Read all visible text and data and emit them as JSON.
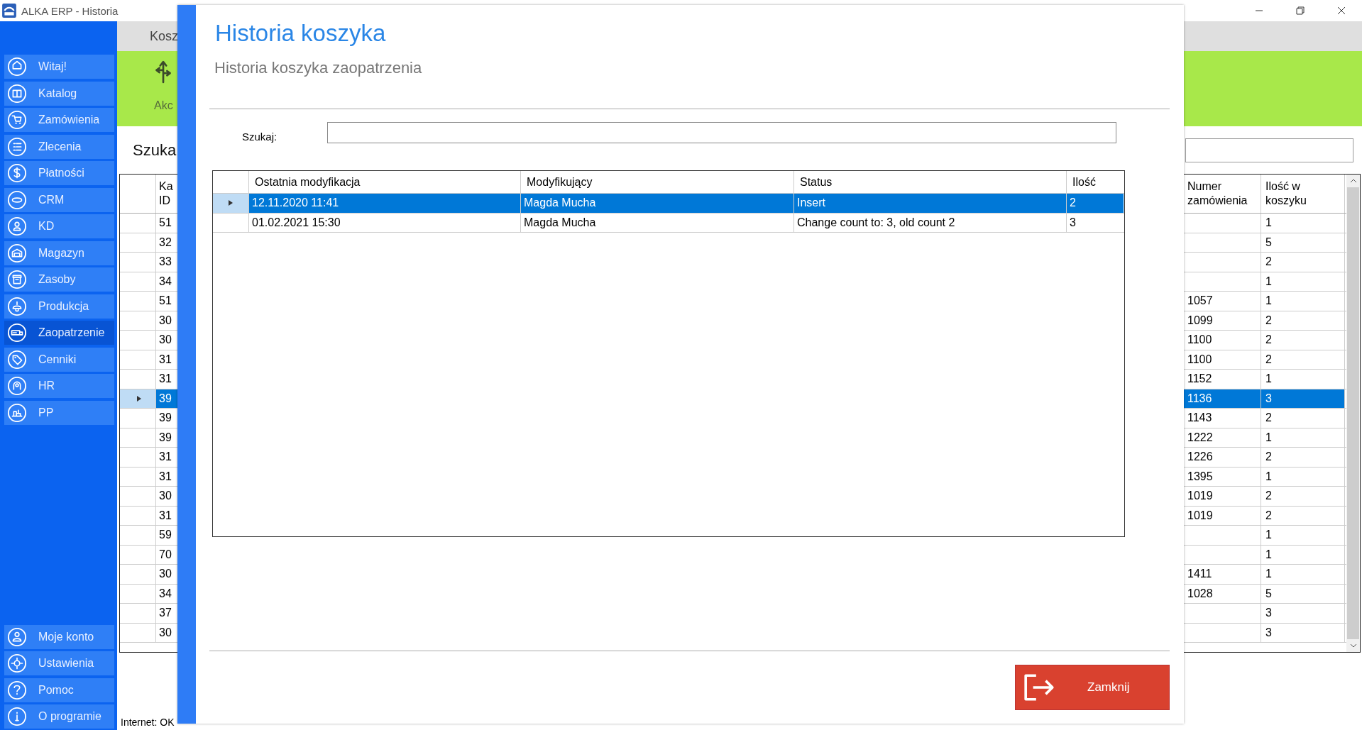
{
  "window": {
    "title": "ALKA ERP - Historia"
  },
  "sidebar": {
    "items": [
      {
        "label": "Witaj!",
        "selected": false
      },
      {
        "label": "Katalog",
        "selected": false
      },
      {
        "label": "Zamówienia",
        "selected": false
      },
      {
        "label": "Zlecenia",
        "selected": false
      },
      {
        "label": "Płatności",
        "selected": false
      },
      {
        "label": "CRM",
        "selected": false
      },
      {
        "label": "KD",
        "selected": false
      },
      {
        "label": "Magazyn",
        "selected": false
      },
      {
        "label": "Zasoby",
        "selected": false
      },
      {
        "label": "Produkcja",
        "selected": false
      },
      {
        "label": "Zaopatrzenie",
        "selected": true
      },
      {
        "label": "Cenniki",
        "selected": false
      },
      {
        "label": "HR",
        "selected": false
      },
      {
        "label": "PP",
        "selected": false
      }
    ],
    "bottom_items": [
      {
        "label": "Moje konto",
        "selected": false
      },
      {
        "label": "Ustawienia",
        "selected": false
      },
      {
        "label": "Pomoc",
        "selected": false
      },
      {
        "label": "O programie",
        "selected": false
      }
    ]
  },
  "ribbon": {
    "tab": "Kosz",
    "action": "Akc"
  },
  "search_heading": "Szuka",
  "table": {
    "columns": [
      "Ka ID",
      "Numer zamówienia",
      "Ilość w koszyku"
    ],
    "rows": [
      {
        "cells": [
          "51",
          "",
          "1"
        ],
        "selected": false
      },
      {
        "cells": [
          "32",
          "",
          "5"
        ],
        "selected": false
      },
      {
        "cells": [
          "33",
          "",
          "2"
        ],
        "selected": false
      },
      {
        "cells": [
          "34",
          "",
          "1"
        ],
        "selected": false
      },
      {
        "cells": [
          "51",
          "1057",
          "1"
        ],
        "selected": false
      },
      {
        "cells": [
          "30",
          "1099",
          "2"
        ],
        "selected": false
      },
      {
        "cells": [
          "30",
          "1100",
          "2"
        ],
        "selected": false
      },
      {
        "cells": [
          "31",
          "1100",
          "2"
        ],
        "selected": false
      },
      {
        "cells": [
          "31",
          "1152",
          "1"
        ],
        "selected": false
      },
      {
        "cells": [
          "39",
          "1136",
          "3"
        ],
        "selected": true
      },
      {
        "cells": [
          "39",
          "1143",
          "2"
        ],
        "selected": false
      },
      {
        "cells": [
          "39",
          "1222",
          "1"
        ],
        "selected": false
      },
      {
        "cells": [
          "31",
          "1226",
          "2"
        ],
        "selected": false
      },
      {
        "cells": [
          "31",
          "1395",
          "1"
        ],
        "selected": false
      },
      {
        "cells": [
          "30",
          "1019",
          "2"
        ],
        "selected": false
      },
      {
        "cells": [
          "31",
          "1019",
          "2"
        ],
        "selected": false
      },
      {
        "cells": [
          "59",
          "",
          "1"
        ],
        "selected": false
      },
      {
        "cells": [
          "70",
          "",
          "1"
        ],
        "selected": false
      },
      {
        "cells": [
          "30",
          "1411",
          "1"
        ],
        "selected": false
      },
      {
        "cells": [
          "34",
          "1028",
          "5"
        ],
        "selected": false
      },
      {
        "cells": [
          "37",
          "",
          "3"
        ],
        "selected": false
      },
      {
        "cells": [
          "30",
          "",
          "3"
        ],
        "selected": false
      }
    ]
  },
  "status_bar": "Internet: OK",
  "dialog": {
    "title": "Historia koszyka",
    "subtitle": "Historia koszyka zaopatrzenia",
    "search_label": "Szukaj:",
    "columns": [
      "Ostatnia modyfikacja",
      "Modyfikujący",
      "Status",
      "Ilość"
    ],
    "rows": [
      {
        "cells": [
          "12.11.2020 11:41",
          "Magda Mucha",
          "Insert",
          "2"
        ],
        "selected": true
      },
      {
        "cells": [
          "01.02.2021 15:30",
          "Magda Mucha",
          "Change count to: 3, old count 2",
          "3"
        ],
        "selected": false
      }
    ],
    "close_button": "Zamknij"
  }
}
